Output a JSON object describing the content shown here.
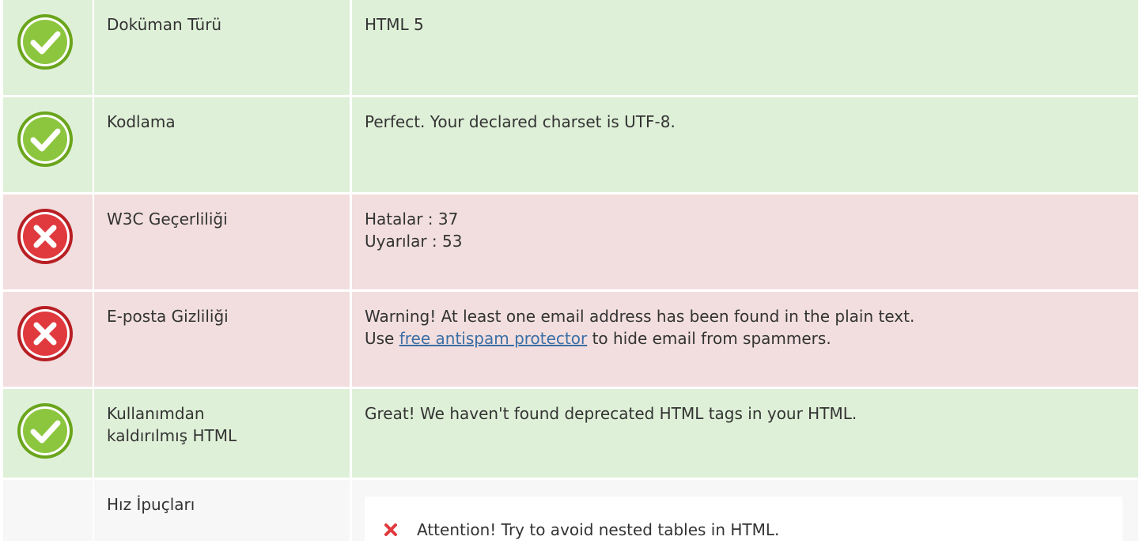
{
  "rows": [
    {
      "status": "ok",
      "label": "Doküman Türü",
      "values": [
        "HTML 5"
      ]
    },
    {
      "status": "ok",
      "label": "Kodlama",
      "values": [
        "Perfect. Your declared charset is UTF-8."
      ]
    },
    {
      "status": "error",
      "label": "W3C Geçerliliği",
      "values": [
        "Hatalar : 37",
        "Uyarılar : 53"
      ]
    },
    {
      "status": "error",
      "label": "E-posta Gizliliği",
      "line1": "Warning! At least one email address has been found in the plain text.",
      "line2_prefix": "Use ",
      "line2_link": "free antispam protector",
      "line2_suffix": " to hide email from spammers."
    },
    {
      "status": "ok",
      "label_line1": "Kullanımdan",
      "label_line2": "kaldırılmış HTML",
      "values": [
        "Great! We haven't found deprecated HTML tags in your HTML."
      ]
    },
    {
      "label": "Hız İpuçları",
      "tips": [
        "Attention! Try to avoid nested tables in HTML."
      ]
    }
  ],
  "colors": {
    "ok_bg": "#dff0d8",
    "error_bg": "#f2dede",
    "ok_icon": "#8cc63f",
    "error_icon": "#e0393e",
    "link": "#3b6ea5",
    "tip_x": "#e0393e"
  },
  "icons": {
    "ok": "check-circle-icon",
    "error": "x-circle-icon",
    "tip": "red-x-icon"
  }
}
